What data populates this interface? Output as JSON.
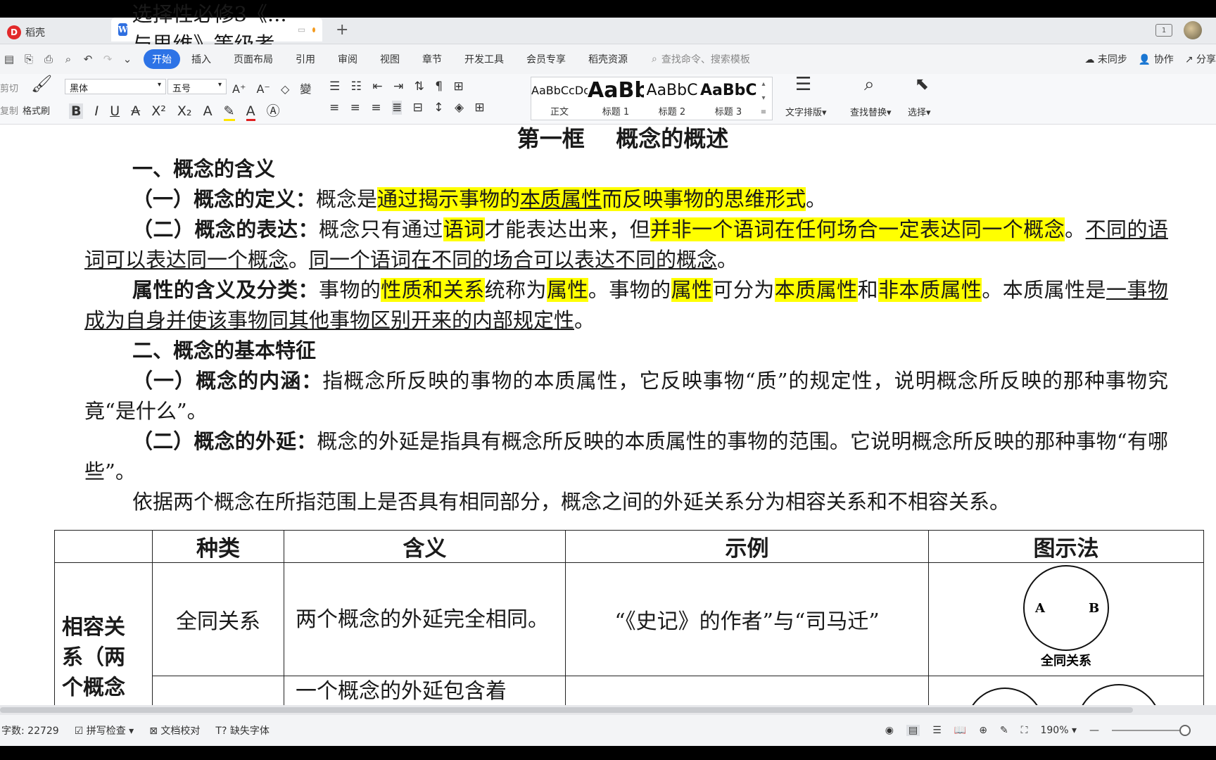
{
  "tabs": {
    "home": "稻壳",
    "doc": "选择性必修3《...与思维》等级考"
  },
  "menu": {
    "items": [
      "开始",
      "插入",
      "页面布局",
      "引用",
      "审阅",
      "视图",
      "章节",
      "开发工具",
      "会员专享",
      "稻壳资源"
    ],
    "search": "查找命令、搜索模板",
    "right": [
      "未同步",
      "协作",
      "分享"
    ]
  },
  "ribbon": {
    "cut": "剪切",
    "copy": "复制",
    "format_painter": "格式刷",
    "font": "黑体",
    "size": "五号",
    "styles": [
      {
        "preview": "AaBbCcDc",
        "label": "正文"
      },
      {
        "preview": "AaBb",
        "label": "标题 1"
      },
      {
        "preview": "AaBbC",
        "label": "标题 2"
      },
      {
        "preview": "AaBbC",
        "label": "标题 3"
      }
    ],
    "text_layout": "文字排版",
    "find_replace": "查找替换",
    "select": "选择"
  },
  "document": {
    "title": "第一框    概念的概述",
    "h1": "一、概念的含义",
    "p1": {
      "lead": "（一）概念的定义：",
      "t1": "概念是",
      "hl1": "通过揭示事物的",
      "hlul": "本质属性",
      "hl2": "而反映事物的思维形式",
      "t2": "。"
    },
    "p2": {
      "lead": "（二）概念的表达：",
      "t1": "概念只有通过",
      "hl1": "语词",
      "t2": "才能表达出来，但",
      "hl2": "并非一个语词在任何场合一定表达同一个概念",
      "t3": "。",
      "ul1": "不同的语词可以表达同一个概念",
      "t4": "。",
      "ul2": "同一个语词在不同的场合可以表达不同的概念",
      "t5": "。"
    },
    "p3": {
      "lead": "属性的含义及分类：",
      "t1": "事物的",
      "hl1": "性质和关系",
      "t2": "统称为",
      "hl2": "属性",
      "t3": "。事物的",
      "hl3": "属性",
      "t4": "可分为",
      "hl4": "本质属性",
      "t5": "和",
      "hl5": "非本质属性",
      "t6": "。本质属性是",
      "ul1": "一事物成为自身并使该事物同其他事物区别开来的内部规定性",
      "t7": "。"
    },
    "h2": "二、概念的基本特征",
    "p4": {
      "lead": "（一）概念的内涵：",
      "text": "指概念所反映的事物的本质属性，它反映事物“质”的规定性，说明概念所反映的那种事物究竟“是什么”。"
    },
    "p5": {
      "lead": "（二）概念的外延：",
      "text": "概念的外延是指具有概念所反映的本质属性的事物的范围。它说明概念所反映的那种事物“有哪些”。"
    },
    "p6": "依据两个概念在所指范围上是否具有相同部分，概念之间的外延关系分为相容关系和不相容关系。",
    "table": {
      "headers": [
        "",
        "种类",
        "含义",
        "示例",
        "图示法"
      ],
      "group": "相容关系（两个概念",
      "row1": {
        "kind": "全同关系",
        "meaning": "两个概念的外延完全相同。",
        "example": "“《史记》的作者”与“司马迁”",
        "diagram_label": "全同关系",
        "a": "A",
        "b": "B"
      },
      "row2": {
        "meaning": "一个概念的外延包含着"
      }
    }
  },
  "status": {
    "word_count": "字数: 22729",
    "spell": "拼写检查",
    "proof": "文档校对",
    "missing_font": "缺失字体",
    "zoom": "190%"
  }
}
